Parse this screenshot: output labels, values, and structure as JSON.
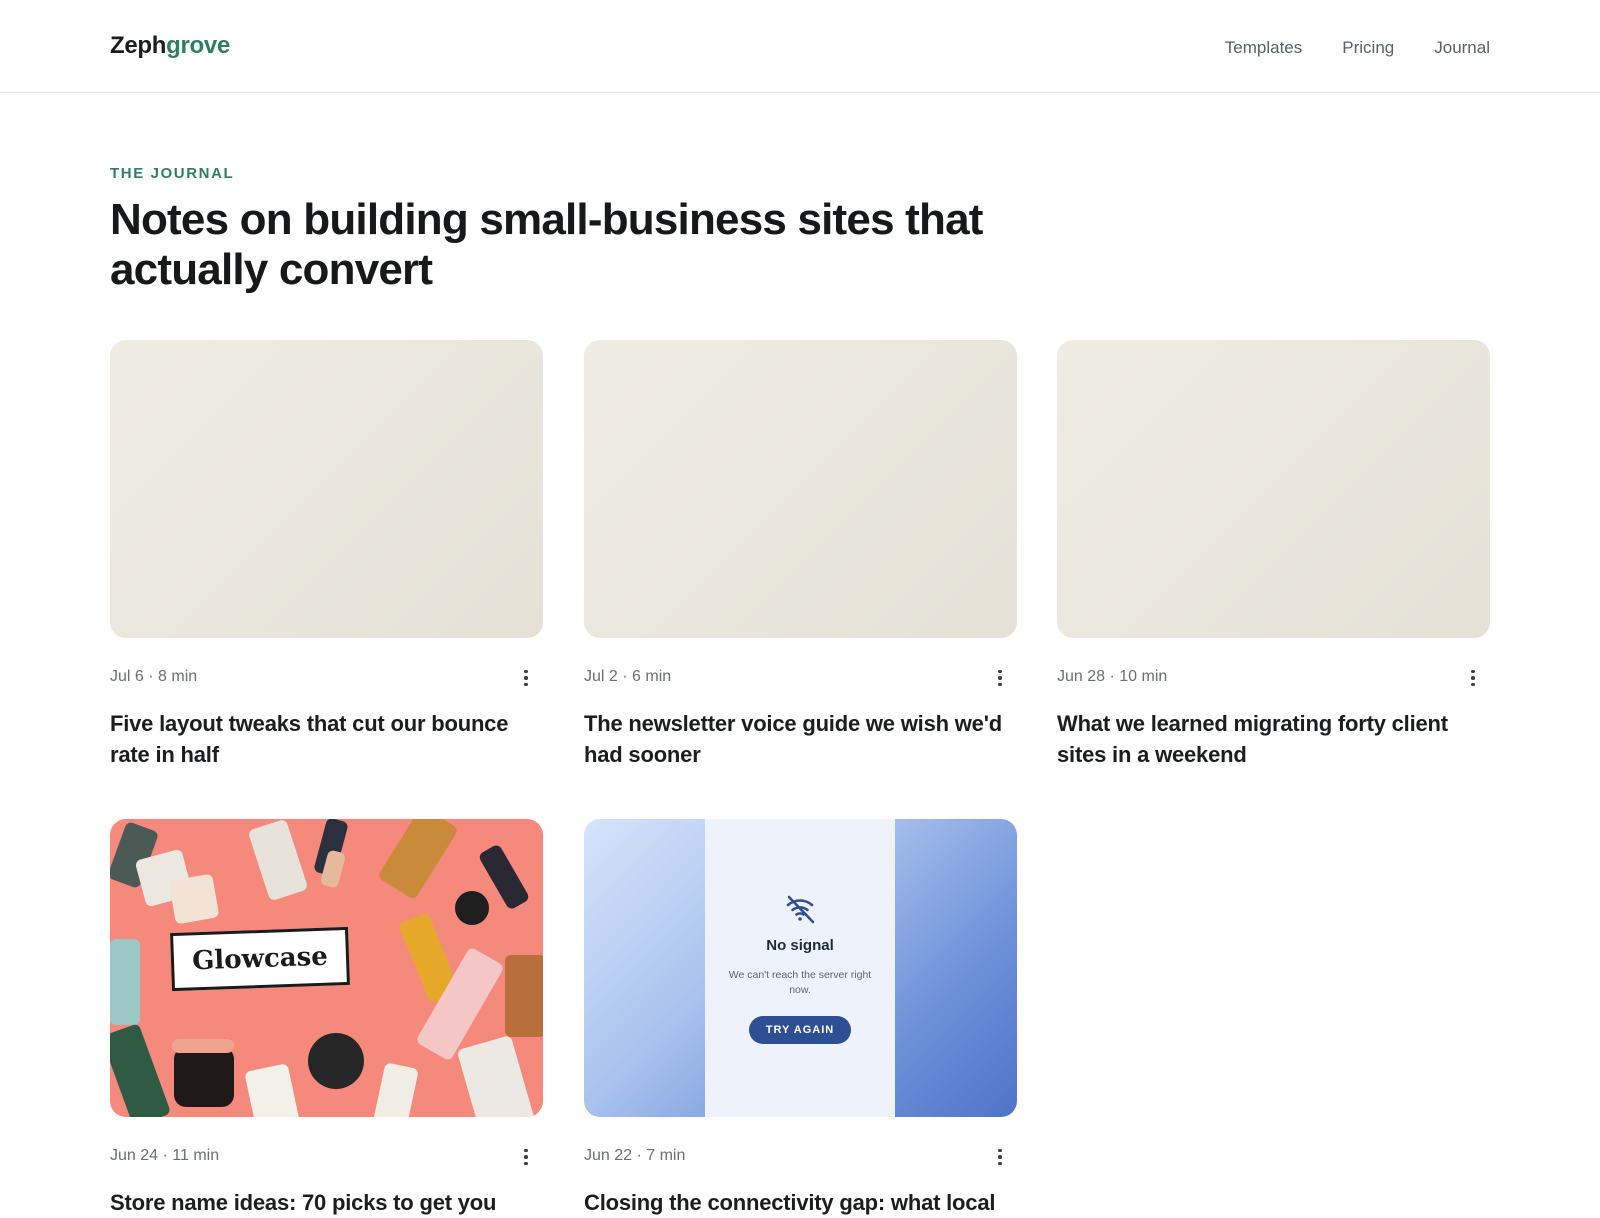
{
  "header": {
    "logo_part1": "Zeph",
    "logo_part2": "grove",
    "nav": [
      {
        "label": "Templates"
      },
      {
        "label": "Pricing"
      },
      {
        "label": "Journal"
      }
    ]
  },
  "hero": {
    "eyebrow": "THE JOURNAL",
    "title": "Notes on building small-business sites that actually convert"
  },
  "posts": [
    {
      "meta": "Jul 6 · 8 min",
      "title": "Five layout tweaks that cut our bounce rate in half"
    },
    {
      "meta": "Jul 2 · 6 min",
      "title": "The newsletter voice guide we wish we'd had sooner"
    },
    {
      "meta": "Jun 28 · 10 min",
      "title": "What we learned migrating forty client sites in a weekend"
    },
    {
      "meta": "Jun 24 · 11 min",
      "title": "Store name ideas: 70 picks to get you",
      "image_label": "Glowcase"
    },
    {
      "meta": "Jun 22 · 7 min",
      "title": "Closing the connectivity gap: what local",
      "image": {
        "title": "No signal",
        "message": "We can't reach the server right now.",
        "button": "TRY AGAIN"
      }
    }
  ],
  "colors": {
    "accent": "#2f7d62",
    "signal_button": "#2f4f94",
    "glow_bg": "#f4897c"
  }
}
